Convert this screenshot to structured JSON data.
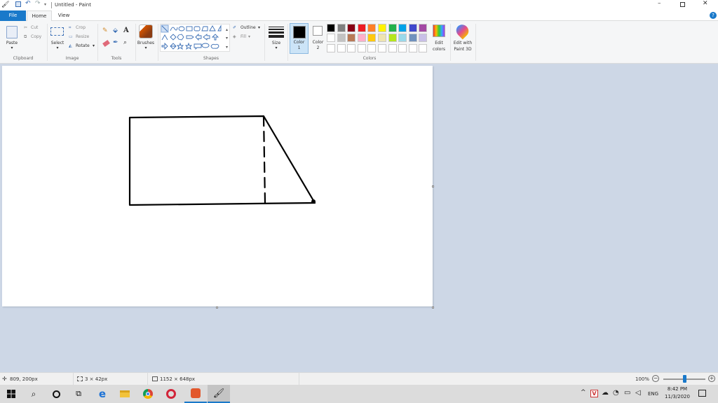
{
  "window": {
    "title": "Untitled - Paint"
  },
  "tabs": [
    {
      "label": "File"
    },
    {
      "label": "Home"
    },
    {
      "label": "View"
    }
  ],
  "ribbon": {
    "clipboard": {
      "paste": "Paste",
      "cut": "Cut",
      "copy": "Copy",
      "label": "Clipboard"
    },
    "image": {
      "select": "Select",
      "crop": "Crop",
      "resize": "Resize",
      "rotate": "Rotate",
      "label": "Image"
    },
    "tools": {
      "label": "Tools"
    },
    "brushes": {
      "label": "Brushes"
    },
    "shapes": {
      "outline": "Outline",
      "fill": "Fill",
      "label": "Shapes"
    },
    "size": {
      "label": "Size"
    },
    "colors": {
      "color1": "Color",
      "color1_num": "1",
      "color2": "Color",
      "color2_num": "2",
      "edit_colors": "Edit",
      "edit_colors2": "colors",
      "edit_paint3d": "Edit with",
      "edit_paint3d2": "Paint 3D",
      "label": "Colors",
      "palette_row1": [
        "#000000",
        "#7f7f7f",
        "#880015",
        "#ed1c24",
        "#ff7f27",
        "#fff200",
        "#22b14c",
        "#00a2e8",
        "#3f48cc",
        "#a349a4"
      ],
      "palette_row2": [
        "#ffffff",
        "#c3c3c3",
        "#b97a57",
        "#ffaec9",
        "#ffc90e",
        "#efe4b0",
        "#b5e61d",
        "#99d9ea",
        "#7092be",
        "#c8bfe7"
      ],
      "accent": "#1979ca"
    }
  },
  "statusbar": {
    "cursor_pos": "809, 200px",
    "selection_size": "3 × 42px",
    "canvas_size": "1152 × 648px",
    "zoom": "100%",
    "zoom_fraction": 0.5
  },
  "taskbar": {
    "lang": "ENG",
    "time": "8:42 PM",
    "date": "11/3/2020"
  }
}
